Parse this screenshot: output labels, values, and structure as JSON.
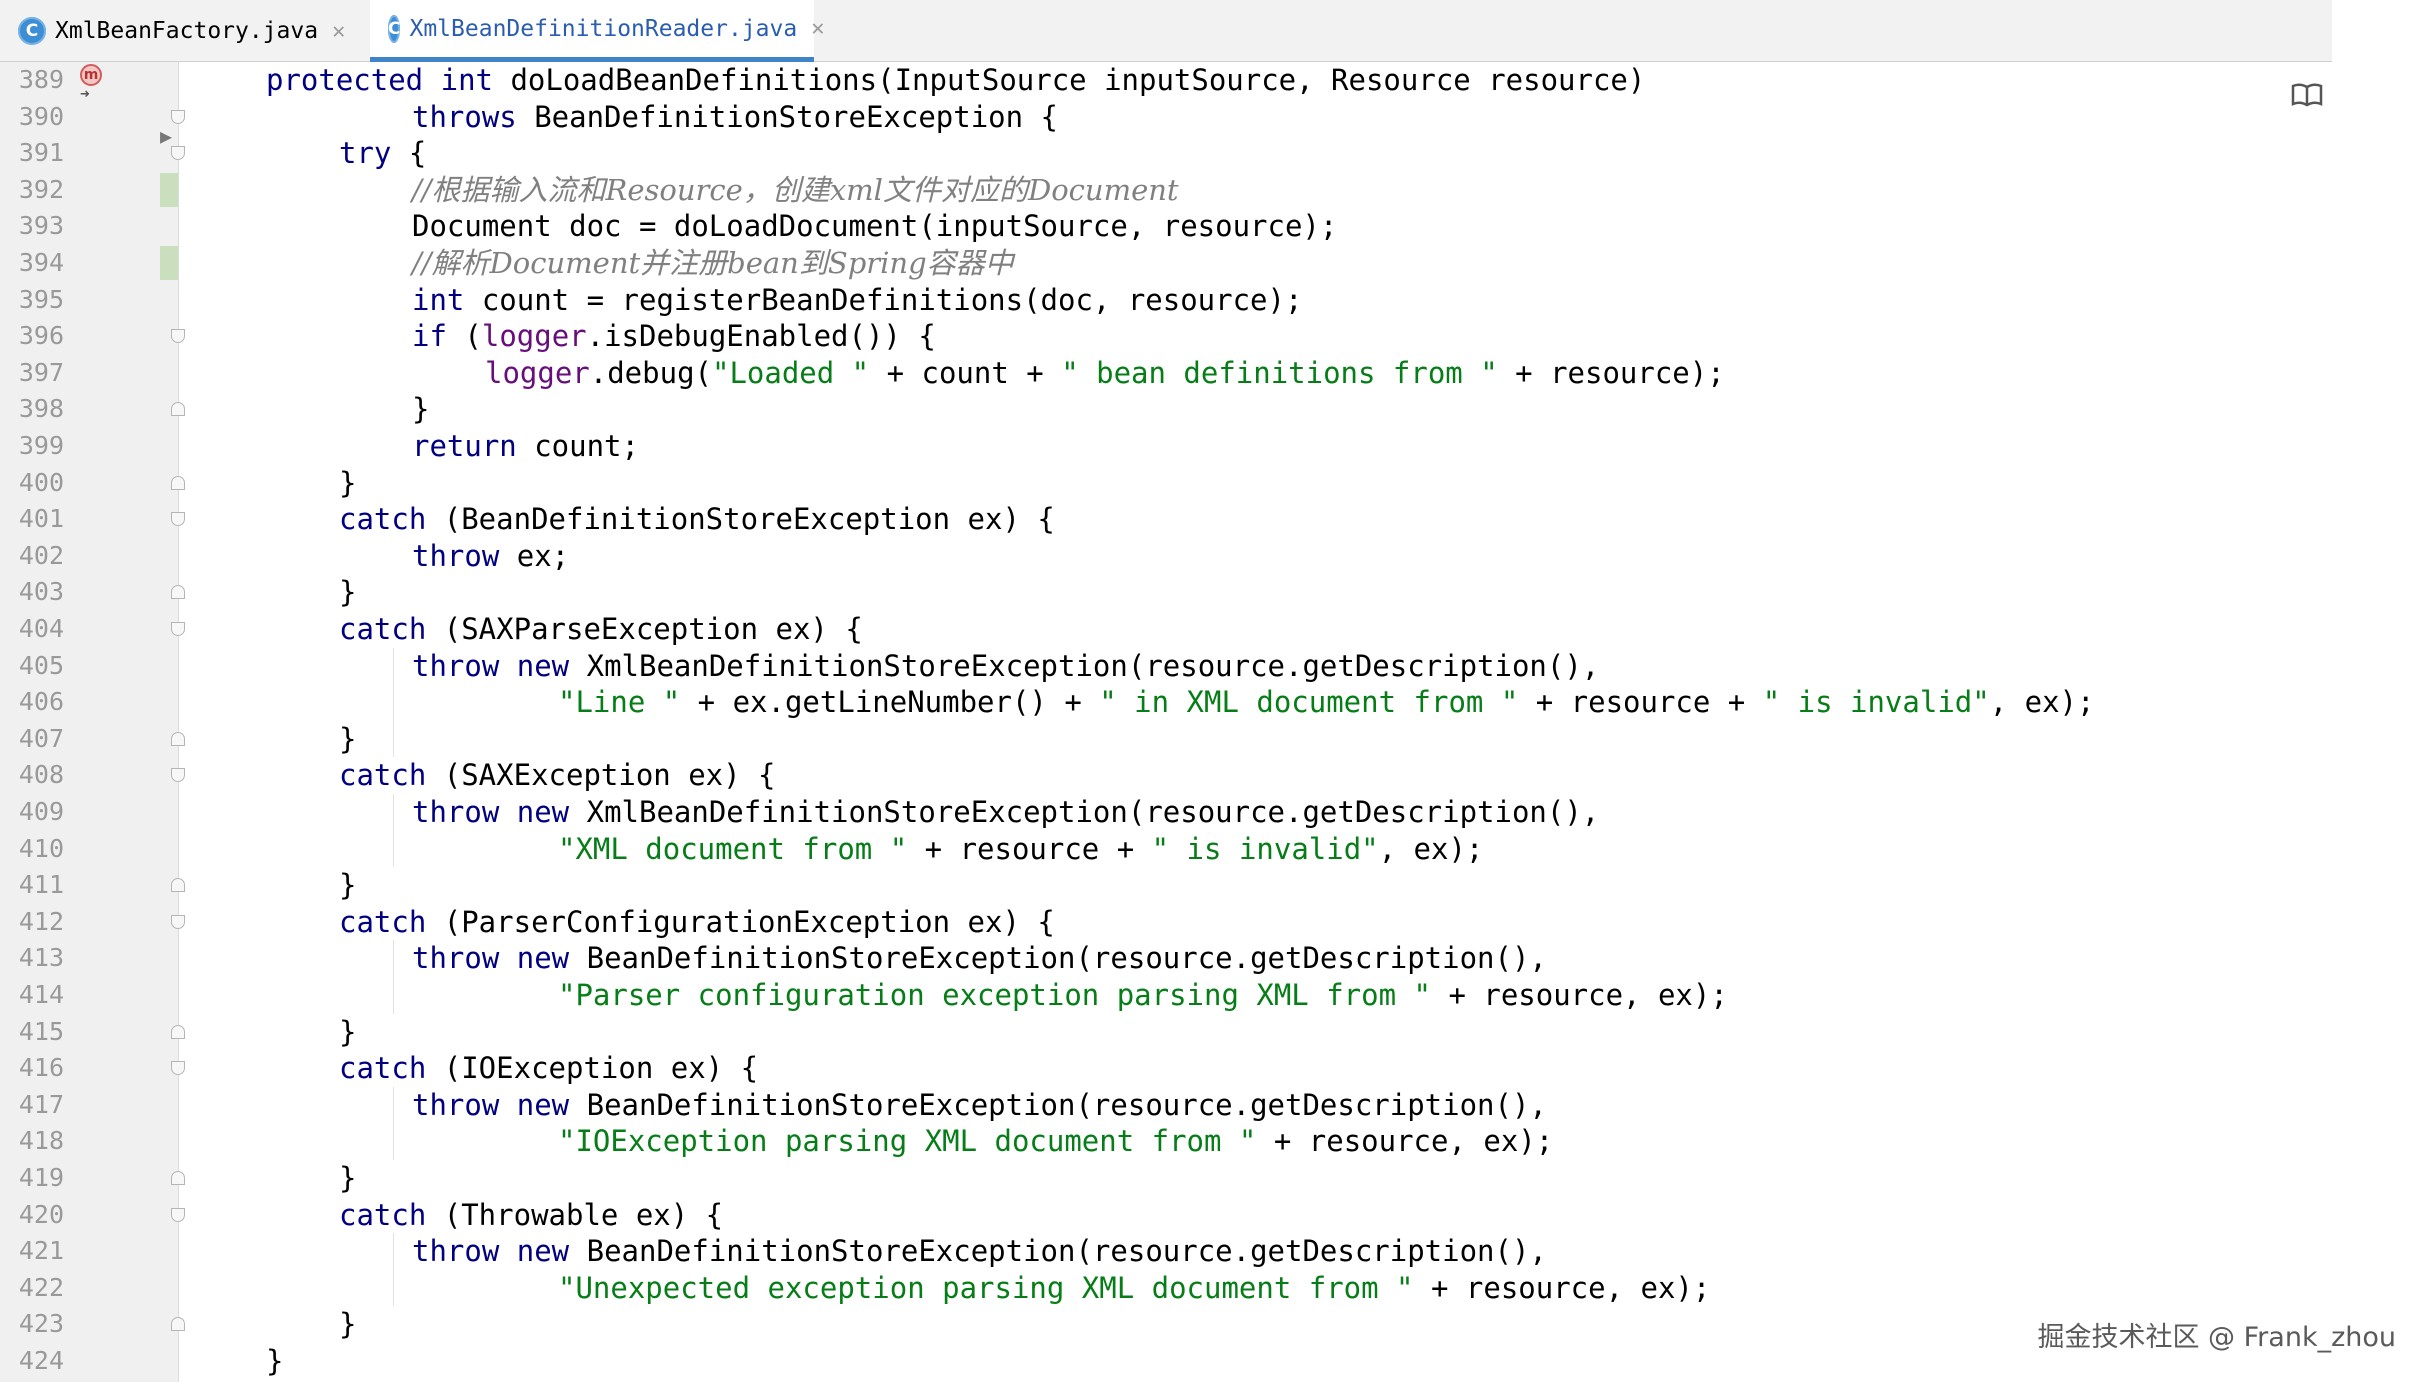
{
  "tabs": [
    {
      "label": "XmlBeanFactory.java",
      "icon": "C",
      "active": false
    },
    {
      "label": "XmlBeanDefinitionReader.java",
      "icon": "C",
      "active": true
    }
  ],
  "editor": {
    "lines": [
      {
        "n": "389",
        "tokens": [
          [
            "kw",
            "protected "
          ],
          [
            "kw",
            "int "
          ],
          [
            "fn",
            "doLoadBeanDefinitions"
          ],
          [
            "",
            "(InputSource inputSource, Resource resource)"
          ]
        ],
        "indent": 2
      },
      {
        "n": "390",
        "tokens": [
          [
            "kw",
            "throws "
          ],
          [
            "",
            "BeanDefinitionStoreException {"
          ]
        ],
        "indent": 4
      },
      {
        "n": "391",
        "tokens": [
          [
            "kw",
            "try "
          ],
          [
            "",
            "{"
          ]
        ],
        "indent": 3
      },
      {
        "n": "392",
        "tokens": [
          [
            "cm",
            "//根据输入流和Resource，创建xml文件对应的Document"
          ]
        ],
        "indent": 4
      },
      {
        "n": "393",
        "tokens": [
          [
            "",
            "Document doc = doLoadDocument(inputSource, resource);"
          ]
        ],
        "indent": 4
      },
      {
        "n": "394",
        "tokens": [
          [
            "cm",
            "//解析Document并注册bean到Spring容器中"
          ]
        ],
        "indent": 4
      },
      {
        "n": "395",
        "tokens": [
          [
            "kw",
            "int "
          ],
          [
            "",
            "count = registerBeanDefinitions(doc, resource);"
          ]
        ],
        "indent": 4
      },
      {
        "n": "396",
        "tokens": [
          [
            "kw",
            "if "
          ],
          [
            "",
            "("
          ],
          [
            "fld",
            "logger"
          ],
          [
            "",
            ".isDebugEnabled()) {"
          ]
        ],
        "indent": 4
      },
      {
        "n": "397",
        "tokens": [
          [
            "fld",
            "logger"
          ],
          [
            "",
            ".debug("
          ],
          [
            "str",
            "\"Loaded \""
          ],
          [
            "",
            " + count + "
          ],
          [
            "str",
            "\" bean definitions from \""
          ],
          [
            "",
            " + resource);"
          ]
        ],
        "indent": 5
      },
      {
        "n": "398",
        "tokens": [
          [
            "",
            "}"
          ]
        ],
        "indent": 4
      },
      {
        "n": "399",
        "tokens": [
          [
            "kw",
            "return "
          ],
          [
            "",
            "count;"
          ]
        ],
        "indent": 4
      },
      {
        "n": "400",
        "tokens": [
          [
            "",
            "}"
          ]
        ],
        "indent": 3
      },
      {
        "n": "401",
        "tokens": [
          [
            "kw",
            "catch "
          ],
          [
            "",
            "(BeanDefinitionStoreException ex) {"
          ]
        ],
        "indent": 3
      },
      {
        "n": "402",
        "tokens": [
          [
            "kw",
            "throw "
          ],
          [
            "",
            "ex;"
          ]
        ],
        "indent": 4
      },
      {
        "n": "403",
        "tokens": [
          [
            "",
            "}"
          ]
        ],
        "indent": 3
      },
      {
        "n": "404",
        "tokens": [
          [
            "kw",
            "catch "
          ],
          [
            "",
            "(SAXParseException ex) {"
          ]
        ],
        "indent": 3
      },
      {
        "n": "405",
        "tokens": [
          [
            "kw",
            "throw new "
          ],
          [
            "",
            "XmlBeanDefinitionStoreException(resource.getDescription(),"
          ]
        ],
        "indent": 4
      },
      {
        "n": "406",
        "tokens": [
          [
            "str",
            "\"Line \""
          ],
          [
            "",
            " + ex.getLineNumber() + "
          ],
          [
            "str",
            "\" in XML document from \""
          ],
          [
            "",
            " + resource + "
          ],
          [
            "str",
            "\" is invalid\""
          ],
          [
            "",
            ", ex);"
          ]
        ],
        "indent": 6
      },
      {
        "n": "407",
        "tokens": [
          [
            "",
            "}"
          ]
        ],
        "indent": 3
      },
      {
        "n": "408",
        "tokens": [
          [
            "kw",
            "catch "
          ],
          [
            "",
            "(SAXException ex) {"
          ]
        ],
        "indent": 3
      },
      {
        "n": "409",
        "tokens": [
          [
            "kw",
            "throw new "
          ],
          [
            "",
            "XmlBeanDefinitionStoreException(resource.getDescription(),"
          ]
        ],
        "indent": 4
      },
      {
        "n": "410",
        "tokens": [
          [
            "str",
            "\"XML document from \""
          ],
          [
            "",
            " + resource + "
          ],
          [
            "str",
            "\" is invalid\""
          ],
          [
            "",
            ", ex);"
          ]
        ],
        "indent": 6
      },
      {
        "n": "411",
        "tokens": [
          [
            "",
            "}"
          ]
        ],
        "indent": 3
      },
      {
        "n": "412",
        "tokens": [
          [
            "kw",
            "catch "
          ],
          [
            "",
            "(ParserConfigurationException ex) {"
          ]
        ],
        "indent": 3
      },
      {
        "n": "413",
        "tokens": [
          [
            "kw",
            "throw new "
          ],
          [
            "",
            "BeanDefinitionStoreException(resource.getDescription(),"
          ]
        ],
        "indent": 4
      },
      {
        "n": "414",
        "tokens": [
          [
            "str",
            "\"Parser configuration exception parsing XML from \""
          ],
          [
            "",
            " + resource, ex);"
          ]
        ],
        "indent": 6
      },
      {
        "n": "415",
        "tokens": [
          [
            "",
            "}"
          ]
        ],
        "indent": 3
      },
      {
        "n": "416",
        "tokens": [
          [
            "kw",
            "catch "
          ],
          [
            "",
            "(IOException ex) {"
          ]
        ],
        "indent": 3
      },
      {
        "n": "417",
        "tokens": [
          [
            "kw",
            "throw new "
          ],
          [
            "",
            "BeanDefinitionStoreException(resource.getDescription(),"
          ]
        ],
        "indent": 4
      },
      {
        "n": "418",
        "tokens": [
          [
            "str",
            "\"IOException parsing XML document from \""
          ],
          [
            "",
            " + resource, ex);"
          ]
        ],
        "indent": 6
      },
      {
        "n": "419",
        "tokens": [
          [
            "",
            "}"
          ]
        ],
        "indent": 3
      },
      {
        "n": "420",
        "tokens": [
          [
            "kw",
            "catch "
          ],
          [
            "",
            "(Throwable ex) {"
          ]
        ],
        "indent": 3
      },
      {
        "n": "421",
        "tokens": [
          [
            "kw",
            "throw new "
          ],
          [
            "",
            "BeanDefinitionStoreException(resource.getDescription(),"
          ]
        ],
        "indent": 4
      },
      {
        "n": "422",
        "tokens": [
          [
            "str",
            "\"Unexpected exception parsing XML document from \""
          ],
          [
            "",
            " + resource, ex);"
          ]
        ],
        "indent": 6
      },
      {
        "n": "423",
        "tokens": [
          [
            "",
            "}"
          ]
        ],
        "indent": 3
      },
      {
        "n": "424",
        "tokens": [
          [
            "",
            "}"
          ]
        ],
        "indent": 2
      }
    ]
  },
  "gutter_icons": {
    "method_marker": "m",
    "method_marker_icon": "method-override-icon",
    "run_icon": "run-arrow-icon",
    "reader_mode_icon": "book-icon"
  },
  "watermark": "掘金技术社区 @ Frank_zhou",
  "colors": {
    "keyword": "#000080",
    "string": "#067d17",
    "field": "#660e7a",
    "comment": "#808080",
    "tab_accent": "#4083c9"
  }
}
